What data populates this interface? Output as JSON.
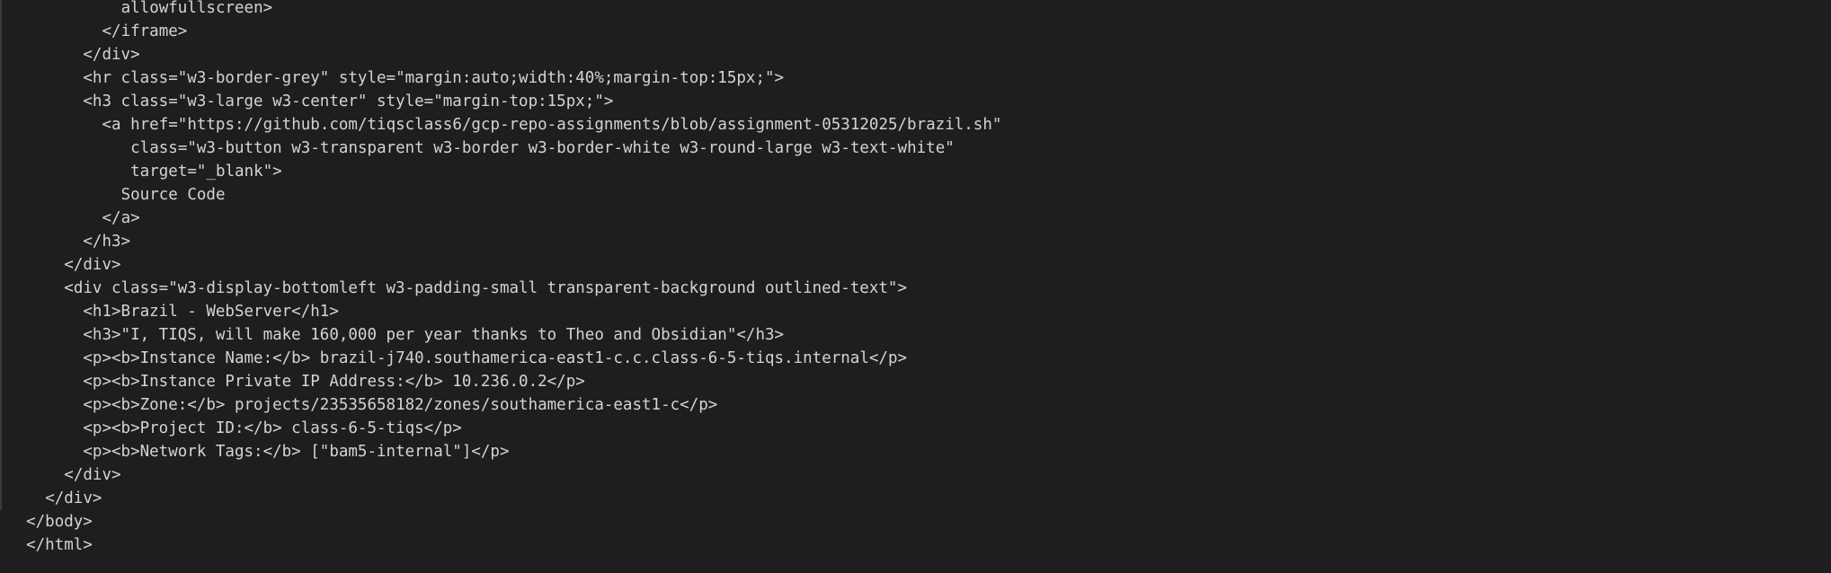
{
  "editor": {
    "lines": [
      {
        "indent": 12,
        "text": "allowfullscreen>"
      },
      {
        "indent": 10,
        "text": "</iframe>"
      },
      {
        "indent": 8,
        "text": "</div>"
      },
      {
        "indent": 8,
        "text": "<hr class=\"w3-border-grey\" style=\"margin:auto;width:40%;margin-top:15px;\">"
      },
      {
        "indent": 8,
        "text": "<h3 class=\"w3-large w3-center\" style=\"margin-top:15px;\">"
      },
      {
        "indent": 10,
        "text": "<a href=\"https://github.com/tiqsclass6/gcp-repo-assignments/blob/assignment-05312025/brazil.sh\""
      },
      {
        "indent": 13,
        "text": "class=\"w3-button w3-transparent w3-border w3-border-white w3-round-large w3-text-white\""
      },
      {
        "indent": 13,
        "text": "target=\"_blank\">"
      },
      {
        "indent": 12,
        "text": "Source Code"
      },
      {
        "indent": 10,
        "text": "</a>"
      },
      {
        "indent": 8,
        "text": "</h3>"
      },
      {
        "indent": 6,
        "text": "</div>"
      },
      {
        "indent": 6,
        "text": "<div class=\"w3-display-bottomleft w3-padding-small transparent-background outlined-text\">"
      },
      {
        "indent": 8,
        "text": "<h1>Brazil - WebServer</h1>"
      },
      {
        "indent": 8,
        "text": "<h3>\"I, TIQS, will make 160,000 per year thanks to Theo and Obsidian\"</h3>"
      },
      {
        "indent": 8,
        "text": "<p><b>Instance Name:</b> brazil-j740.southamerica-east1-c.c.class-6-5-tiqs.internal</p>"
      },
      {
        "indent": 8,
        "text": "<p><b>Instance Private IP Address:</b> 10.236.0.2</p>"
      },
      {
        "indent": 8,
        "text": "<p><b>Zone:</b> projects/23535658182/zones/southamerica-east1-c</p>"
      },
      {
        "indent": 8,
        "text": "<p><b>Project ID:</b> class-6-5-tiqs</p>"
      },
      {
        "indent": 8,
        "text": "<p><b>Network Tags:</b> [\"bam5-internal\"]</p>"
      },
      {
        "indent": 6,
        "text": "</div>"
      },
      {
        "indent": 4,
        "text": "</div>"
      },
      {
        "indent": 2,
        "text": "</body>"
      },
      {
        "indent": 2,
        "text": "</html>"
      }
    ]
  },
  "colors": {
    "background": "#1e1e1e",
    "text": "#d4d4d4",
    "gutter": "#3a3a3a"
  }
}
